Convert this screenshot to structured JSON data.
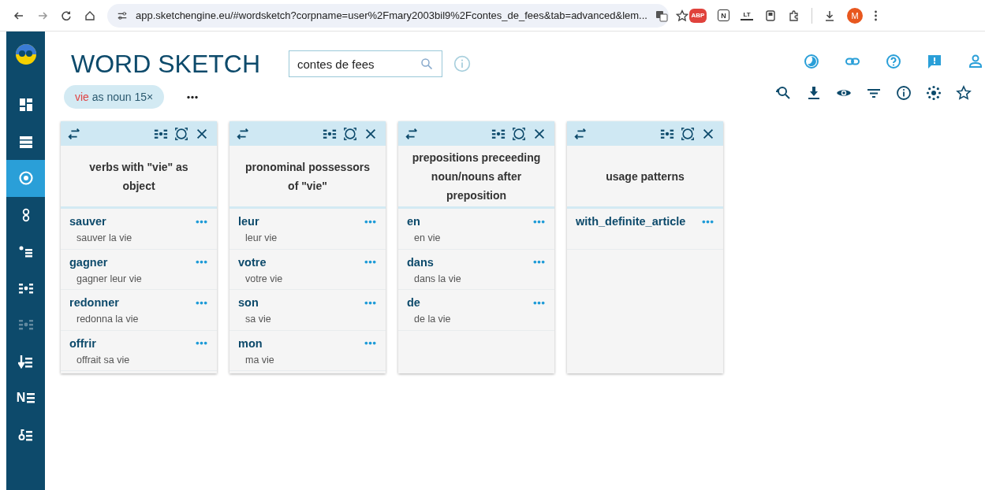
{
  "browser": {
    "url": "app.sketchengine.eu/#wordsketch?corpname=user%2Fmary2003bil9%2Fcontes_de_fees&tab=advanced&lem...",
    "extensions": [
      {
        "kind": "abp",
        "text": "ABP"
      },
      {
        "kind": "notion",
        "text": "N"
      },
      {
        "kind": "lt",
        "text": "LT"
      },
      {
        "kind": "clipboard"
      },
      {
        "kind": "puzzle"
      }
    ],
    "avatar": "M"
  },
  "sidebar": {
    "items": [
      {
        "kind": "dashboard",
        "selected": false,
        "disabled": false
      },
      {
        "kind": "list",
        "selected": false,
        "disabled": false
      },
      {
        "kind": "target",
        "selected": true,
        "disabled": false
      },
      {
        "kind": "circles",
        "selected": false,
        "disabled": false
      },
      {
        "kind": "dotlist",
        "selected": false,
        "disabled": false
      },
      {
        "kind": "sketch",
        "selected": false,
        "disabled": false
      },
      {
        "kind": "sketchdiff",
        "selected": false,
        "disabled": true
      },
      {
        "kind": "arrowlist",
        "selected": false,
        "disabled": false
      },
      {
        "kind": "nlist",
        "text": "N",
        "selected": false,
        "disabled": false
      },
      {
        "kind": "keylist",
        "selected": false,
        "disabled": false
      }
    ]
  },
  "header": {
    "title": "WORD SKETCH",
    "search": {
      "value": "contes de fees"
    }
  },
  "chip": {
    "lemma": "vie",
    "rest": "as noun 15×"
  },
  "cards": [
    {
      "title": "verbs with \"vie\" as object",
      "rows": [
        {
          "word": "sauver",
          "example": "sauver la vie"
        },
        {
          "word": "gagner",
          "example": "gagner leur vie"
        },
        {
          "word": "redonner",
          "example": "redonna la vie"
        },
        {
          "word": "offrir",
          "example": "offrait sa vie"
        }
      ]
    },
    {
      "title": "pronominal possessors of \"vie\"",
      "rows": [
        {
          "word": "leur",
          "example": "leur vie"
        },
        {
          "word": "votre",
          "example": "votre vie"
        },
        {
          "word": "son",
          "example": "sa vie"
        },
        {
          "word": "mon",
          "example": "ma vie"
        }
      ]
    },
    {
      "title": "prepositions preceeding noun/nouns after preposition",
      "rows": [
        {
          "word": "en",
          "example": "en vie"
        },
        {
          "word": "dans",
          "example": "dans la vie"
        },
        {
          "word": "de",
          "example": "de la vie"
        }
      ]
    },
    {
      "title": "usage patterns",
      "rows": [
        {
          "word": "with_definite_article"
        }
      ]
    }
  ]
}
